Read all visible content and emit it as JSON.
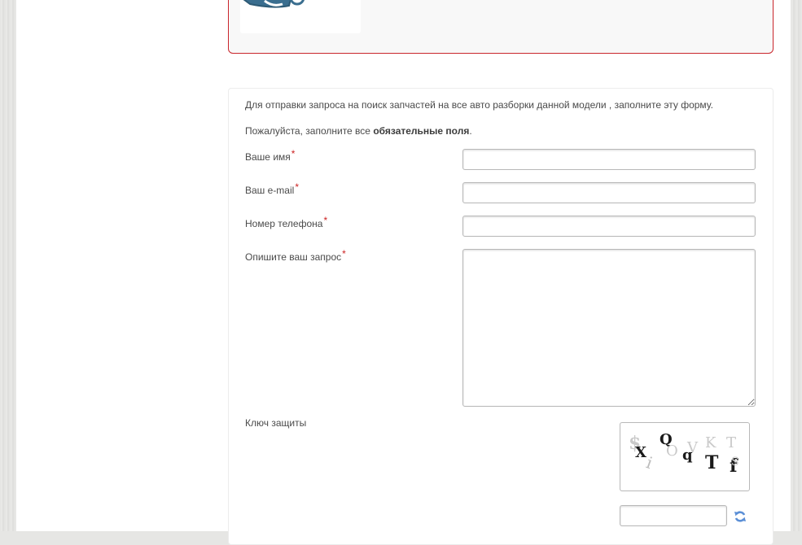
{
  "logo": {
    "icon": "car-logo-icon",
    "color": "#3a6e8f"
  },
  "form": {
    "intro": "Для отправки запроса на поиск запчастей на все авто разборки данной модели , заполните эту форму.",
    "required_prefix": "Пожалуйста, заполните все ",
    "required_bold": "обязательные поля",
    "required_suffix": ".",
    "required_mark": "*",
    "fields": [
      {
        "label": "Ваше имя",
        "value": ""
      },
      {
        "label": "Ваш e-mail",
        "value": ""
      },
      {
        "label": "Номер телефона",
        "value": ""
      },
      {
        "label": "Опишите ваш запрос",
        "value": ""
      }
    ],
    "captcha": {
      "label": "Ключ защиты",
      "icon": "captcha-image",
      "value": "",
      "refresh_icon": "refresh-icon"
    }
  },
  "colors": {
    "accent_red": "#c9252b",
    "required_red": "#cc2222",
    "refresh_blue": "#5b8fd6"
  }
}
